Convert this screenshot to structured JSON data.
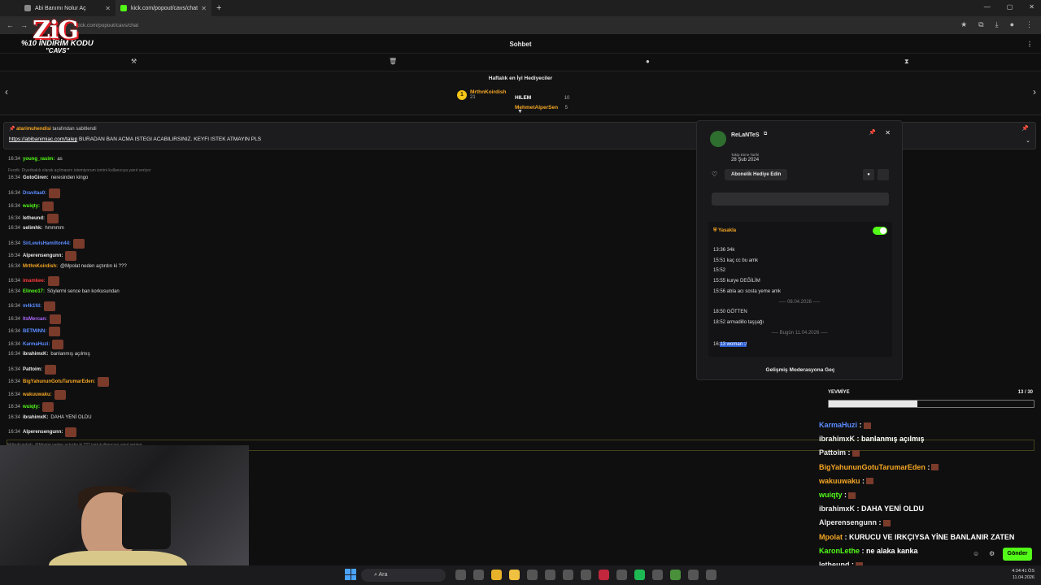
{
  "browser": {
    "tabs": [
      "Abi Banımı Nolur Aç",
      "kick.com/popout/cavs/chat"
    ],
    "url": "kick.com/popout/cavs/chat"
  },
  "overlay": {
    "brand": "ZiG",
    "promo": "%10 İNDİRİM KODU",
    "code": "\"CAVS\""
  },
  "header": {
    "title": "Sohbet"
  },
  "gifters": {
    "title": "Haftalık en İyi Hediyeciler",
    "list": [
      {
        "name": "MrthnKoirdish",
        "value": "21"
      },
      {
        "name": "HILEM",
        "value": "10"
      },
      {
        "name": "MehmetAlperSen",
        "value": "5"
      }
    ]
  },
  "pinned": {
    "by": "atarimuhendisi",
    "by_suffix": "tarafından sabitlendi",
    "link": "https://abibanimiac.com/talep",
    "text": "BURADAN BAN ACMA ISTEGI ACABILIRSINIZ. KEYFI ISTEK ATMAYIN PLS"
  },
  "chat": [
    {
      "t": "16:34",
      "u": "young_rasim",
      "c": "#53fc18",
      "m": "as"
    },
    {
      "t": "",
      "u": "",
      "c": "",
      "m": "Feorik: Diyerbakılı olarak açılmasını istemiyorum ismini kullanıcıya yanıt veriyor",
      "reply": true
    },
    {
      "t": "16:34",
      "u": "GotoGiren",
      "c": "#e8e8e8",
      "m": "neresinden kingo"
    },
    {
      "t": "16:34",
      "u": "Dravitaa0",
      "c": "#5b8cff",
      "m": ":"
    },
    {
      "t": "16:34",
      "u": "wuiqty",
      "c": "#53fc18",
      "m": ":"
    },
    {
      "t": "16:34",
      "u": "letheund",
      "c": "#e8e8e8",
      "m": ":"
    },
    {
      "t": "16:34",
      "u": "selimhk",
      "c": "#e8e8e8",
      "m": "hmmmm"
    },
    {
      "t": "16:34",
      "u": "SirLewisHamilton44",
      "c": "#5b8cff",
      "m": ":"
    },
    {
      "t": "16:34",
      "u": "Alperensengunn",
      "c": "#e8e8e8",
      "m": ":"
    },
    {
      "t": "16:34",
      "u": "MrthnKoirdish",
      "c": "#f5a623",
      "m": "@Mpolat neden açtırdın ki ???"
    },
    {
      "t": "16:34",
      "u": "imamkee",
      "c": "#ff3b3b",
      "m": ":"
    },
    {
      "t": "16:34",
      "u": "Elinoo17",
      "c": "#53fc18",
      "m": "Söylermi sence ban korkusundan"
    },
    {
      "t": "16:34",
      "u": "m4k1fd",
      "c": "#5b8cff",
      "m": ":"
    },
    {
      "t": "16:34",
      "u": "ItsMercan",
      "c": "#b067ff",
      "m": ":"
    },
    {
      "t": "16:34",
      "u": "BETMINN",
      "c": "#5b8cff",
      "m": ":"
    },
    {
      "t": "16:34",
      "u": "KarmaHuzi",
      "c": "#5b8cff",
      "m": ":"
    },
    {
      "t": "16:34",
      "u": "ibrahimxK",
      "c": "#e8e8e8",
      "m": "banlanmış açılmış"
    },
    {
      "t": "16:34",
      "u": "Pattoim",
      "c": "#e8e8e8",
      "m": ":"
    },
    {
      "t": "16:34",
      "u": "BigYahununGotuTarumarEden",
      "c": "#f5a623",
      "m": ":"
    },
    {
      "t": "16:34",
      "u": "wakuuwaku",
      "c": "#f5a623",
      "m": ":"
    },
    {
      "t": "16:34",
      "u": "wuiqty",
      "c": "#53fc18",
      "m": ":"
    },
    {
      "t": "16:34",
      "u": "ibrahimxK",
      "c": "#e8e8e8",
      "m": "DAHA YENİ OLDU"
    },
    {
      "t": "16:34",
      "u": "Alperensengunn",
      "c": "#e8e8e8",
      "m": ":"
    }
  ],
  "reply_bottom": "MrthnKoirdish: @Mpolat neden açtırdın ki ??? ismi kullanıcıya yanıt veriyor",
  "modcard": {
    "user": "ReLaNTeS",
    "follow_label": "Takip Etme Tarihi",
    "follow_date": "28 Şub 2024",
    "gift_button": "Abonelik Hediye Edin",
    "ban_label": "Yasakla",
    "log": [
      {
        "t": "13:36 34k"
      },
      {
        "t": "15:51 kaç cc bu amk"
      },
      {
        "t": "15:52"
      },
      {
        "t": "15:55 kurye DEĞİLİM"
      },
      {
        "t": "15:56 abla acı sosta yeme amk"
      },
      {
        "sep": "08.04.2026"
      },
      {
        "t": "18:50 GÖTTEN"
      },
      {
        "t": "18:52 armadillo taşşağı"
      },
      {
        "sep": "Bugün 11.04.2026"
      }
    ],
    "last_pre": "16:",
    "last_hl": "13 woman :/",
    "advanced": "Gelişmiş Moderasyona Geç"
  },
  "goal": {
    "label": "YEVMİYE",
    "count": "13 / 30",
    "progress": 0.433
  },
  "right_chat": [
    {
      "u": "KarmaHuzi",
      "c": "#5b8cff",
      "m": ":"
    },
    {
      "u": "ibrahimxK",
      "c": "#e8e8e8",
      "m": ": banlanmış açılmış"
    },
    {
      "u": "Pattoim",
      "c": "#e8e8e8",
      "m": ":"
    },
    {
      "u": "BigYahununGotuTarumarEden",
      "c": "#f5a623",
      "m": ":"
    },
    {
      "u": "wakuuwaku",
      "c": "#f5a623",
      "m": ":"
    },
    {
      "u": "wuiqty",
      "c": "#53fc18",
      "m": ":"
    },
    {
      "u": "ibrahimxK",
      "c": "#e8e8e8",
      "m": ": DAHA YENİ OLDU"
    },
    {
      "u": "Alperensengunn",
      "c": "#e8e8e8",
      "m": ":"
    },
    {
      "u": "Mpolat",
      "c": "#f5a623",
      "m": ": KURUCU VE IRKÇIYSA YİNE BANLANIR ZATEN"
    },
    {
      "u": "KaronLethe",
      "c": "#53fc18",
      "m": ": ne alaka kanka"
    },
    {
      "u": "letheund",
      "c": "#e8e8e8",
      "m": ":"
    }
  ],
  "send": "Gönder",
  "taskbar": {
    "search": "Ara",
    "time": "4:34:41 ÖS",
    "date": "11.04.2026"
  }
}
